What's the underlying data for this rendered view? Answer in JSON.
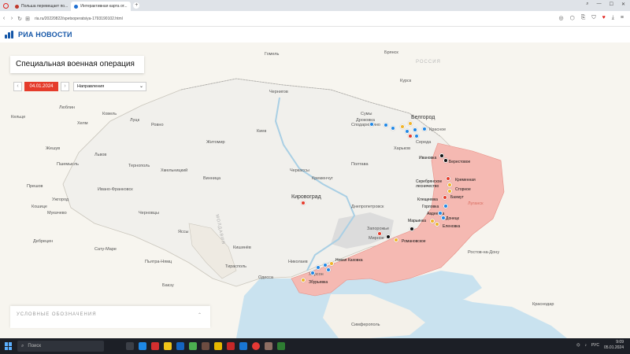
{
  "browser": {
    "tabs": [
      {
        "label": "Польша перевещает по..."
      },
      {
        "label": "Интерактивная карта от..."
      }
    ],
    "url": "ria.ru/20220822/spetsoperatsiya-1793190102.html",
    "url_host": "ria.ru"
  },
  "site": {
    "logo_text": "РИА НОВОСТИ"
  },
  "panel": {
    "title": "Специальная военная операция",
    "date": "04.01.2024",
    "direction_placeholder": "Направления"
  },
  "legend": {
    "label": "УСЛОВНЫЕ ОБОЗНАЧЕНИЯ"
  },
  "colors": {
    "occupied_area": "#f5b9b2",
    "contested_area": "#dcdcdc",
    "water": "#c9e2ef",
    "blue_marker": "#1f87e5",
    "yellow_marker": "#f0b429",
    "red_marker": "#e53c2b",
    "black_marker": "#111111",
    "date_accent": "#e53c2b"
  },
  "map": {
    "regions": [
      "РОССИЯ",
      "МОЛДАВИЯ",
      "Луганск"
    ],
    "cities": [
      "Гомель",
      "Брянск",
      "Чернигов",
      "Курск",
      "Сумы",
      "Дроковка",
      "Сподарюшино",
      "Белгород",
      "Красное",
      "Середа",
      "Харьков",
      "Житомир",
      "Киев",
      "Полтава",
      "Ровно",
      "Луцк",
      "Ковель",
      "Львов",
      "Тернополь",
      "Хмельницкий",
      "Винница",
      "Черкассы",
      "Кировоград",
      "Днепропетровск",
      "Ивано-Франковск",
      "Черновцы",
      "Ужгород",
      "Мукачево",
      "Кошице",
      "Люблин",
      "Хелм",
      "Жешув",
      "Пшемысль",
      "Кельце",
      "Прешов",
      "Дебрецен",
      "Сату-Маре",
      "Кишинёв",
      "Пьятра-Нямц",
      "Бакэу",
      "Яссы",
      "Тирасполь",
      "Николаев",
      "Одесса",
      "Запорожье",
      "Мирное",
      "Херсон",
      "Новая Каховка",
      "Збурьевка",
      "Романовское",
      "Ивановка",
      "Берестовое",
      "Серебрянское лесничество",
      "Кременная",
      "Сторное",
      "Бахмут",
      "Клещеевка",
      "Горловка",
      "Авдеевка",
      "Донецк",
      "Марьинка",
      "Еленовка",
      "Ростов-на-Дону",
      "Симферополь",
      "Краснодар",
      "Кременчуг"
    ]
  },
  "taskbar": {
    "search_label": "Поиск",
    "language": "РУС",
    "time": "9:09",
    "date": "05.01.2024"
  }
}
